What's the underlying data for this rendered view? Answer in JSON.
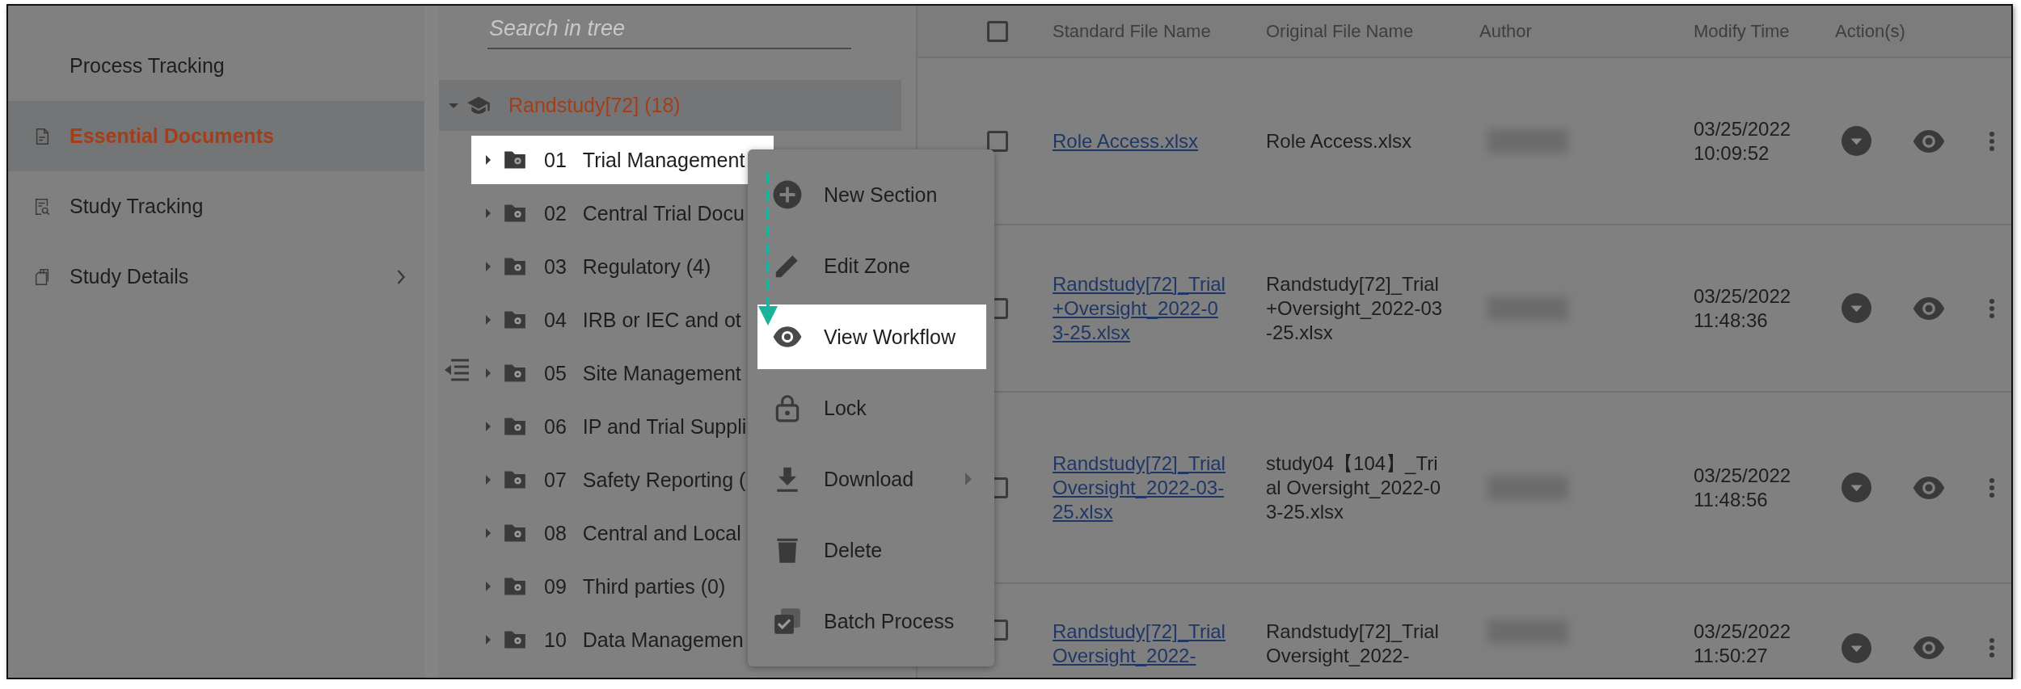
{
  "sidebar": {
    "items": [
      {
        "label": "Process Tracking",
        "selected": false,
        "has_submenu": false
      },
      {
        "label": "Essential Documents",
        "selected": true,
        "has_submenu": false
      },
      {
        "label": "Study Tracking",
        "selected": false,
        "has_submenu": false
      },
      {
        "label": "Study Details",
        "selected": false,
        "has_submenu": true
      }
    ]
  },
  "tree": {
    "search": {
      "placeholder": "Search in tree"
    },
    "root": {
      "label": "Randstudy[72] (18)",
      "selected": true,
      "expanded": true,
      "children": [
        {
          "number": "01",
          "label": "Trial Management",
          "highlighted": true,
          "expanded": false
        },
        {
          "number": "02",
          "label": "Central Trial Docu",
          "highlighted": false,
          "expanded": false
        },
        {
          "number": "03",
          "label": "Regulatory (4)",
          "highlighted": false,
          "expanded": false
        },
        {
          "number": "04",
          "label": "IRB or IEC and ot",
          "highlighted": false,
          "expanded": false
        },
        {
          "number": "05",
          "label": "Site Management",
          "highlighted": false,
          "expanded": false
        },
        {
          "number": "06",
          "label": "IP and Trial Suppli",
          "highlighted": false,
          "expanded": false
        },
        {
          "number": "07",
          "label": "Safety Reporting (",
          "highlighted": false,
          "expanded": false
        },
        {
          "number": "08",
          "label": "Central and Local",
          "highlighted": false,
          "expanded": false
        },
        {
          "number": "09",
          "label": "Third parties (0)",
          "highlighted": false,
          "expanded": false
        },
        {
          "number": "10",
          "label": "Data Managemen",
          "highlighted": false,
          "expanded": false
        }
      ]
    }
  },
  "table": {
    "select_all_checked": false,
    "columns": [
      "Standard File Name",
      "Original File Name",
      "Author",
      "Modify Time",
      "Action(s)"
    ],
    "rows": [
      {
        "checked": false,
        "standard_file_name": "Role Access.xlsx",
        "original_file_name": "Role Access.xlsx",
        "modify_date": "03/25/2022",
        "modify_time": "10:09:52"
      },
      {
        "checked": false,
        "standard_file_name": "Randstudy[72]_Trial+Oversight_2022-03-25.xlsx",
        "original_file_name": "Randstudy[72]_Trial+Oversight_2022-03-25.xlsx",
        "modify_date": "03/25/2022",
        "modify_time": "11:48:36"
      },
      {
        "checked": false,
        "standard_file_name": "Randstudy[72]_Trial Oversight_2022-03-25.xlsx",
        "original_file_name": "study04【104】_Trial Oversight_2022-03-25.xlsx",
        "modify_date": "03/25/2022",
        "modify_time": "11:48:56"
      },
      {
        "checked": false,
        "standard_file_name": "Randstudy[72]_Trial Oversight_2022-",
        "original_file_name": "Randstudy[72]_Trial Oversight_2022-",
        "modify_date": "03/25/2022",
        "modify_time": "11:50:27"
      }
    ]
  },
  "context_menu": {
    "items": [
      {
        "label": "New Section",
        "highlighted": false,
        "has_submenu": false
      },
      {
        "label": "Edit Zone",
        "highlighted": false,
        "has_submenu": false
      },
      {
        "label": "View Workflow",
        "highlighted": true,
        "has_submenu": false
      },
      {
        "label": "Lock",
        "highlighted": false,
        "has_submenu": false
      },
      {
        "label": "Download",
        "highlighted": false,
        "has_submenu": true
      },
      {
        "label": "Delete",
        "highlighted": false,
        "has_submenu": false
      },
      {
        "label": "Batch Process",
        "highlighted": false,
        "has_submenu": false
      }
    ]
  }
}
